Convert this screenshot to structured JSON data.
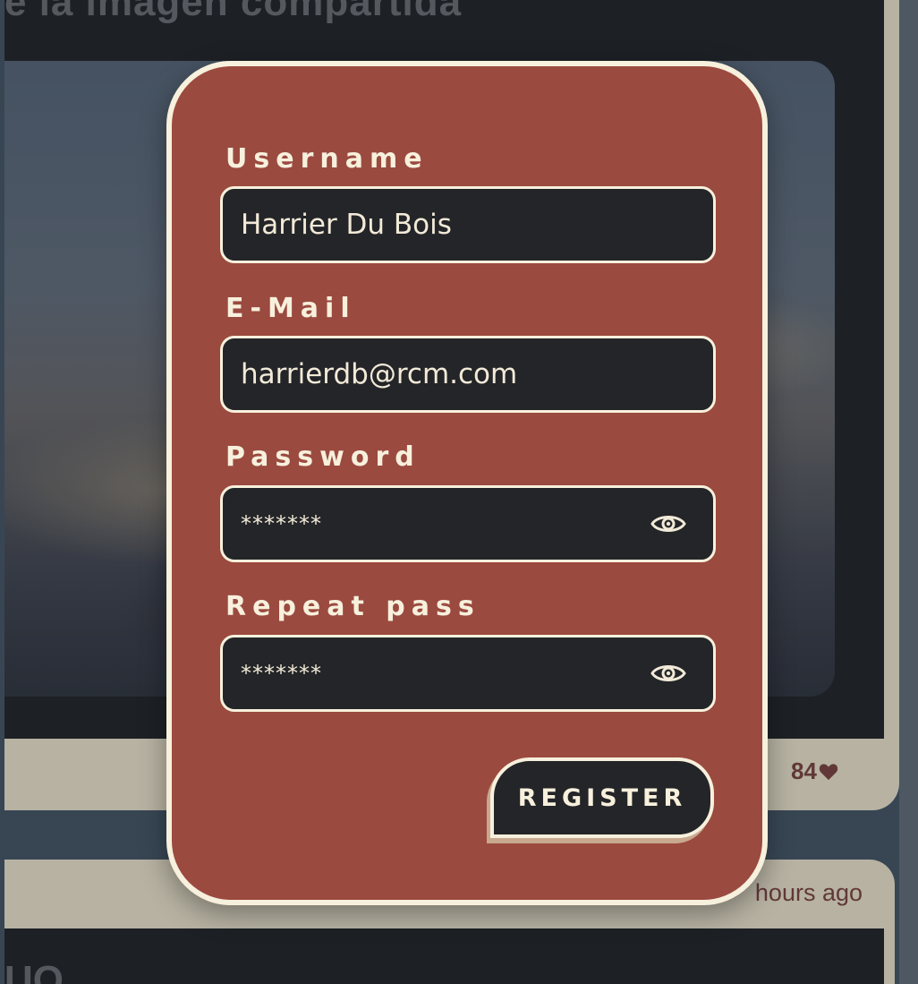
{
  "background": {
    "post_heading": "e la imagen compartida",
    "post_likes": "84",
    "post_time": "hours ago",
    "second_post_heading": "UO"
  },
  "form": {
    "username_label": "Username",
    "username_value": "Harrier Du Bois",
    "email_label": "E-Mail",
    "email_value": "harrierdb@rcm.com",
    "password_label": "Password",
    "password_value": "*******",
    "repeat_label": "Repeat pass",
    "repeat_value": "*******",
    "register_label": "REGISTER"
  },
  "icons": {
    "password_toggle": "eye-icon",
    "repeat_toggle": "eye-icon",
    "likes": "heart-icon"
  },
  "colors": {
    "modal_bg": "#9b4a40",
    "modal_border": "#f7f0dc",
    "input_bg": "#242528",
    "page_bg": "#3d4c5c",
    "accent_text": "#6a3d3c"
  }
}
